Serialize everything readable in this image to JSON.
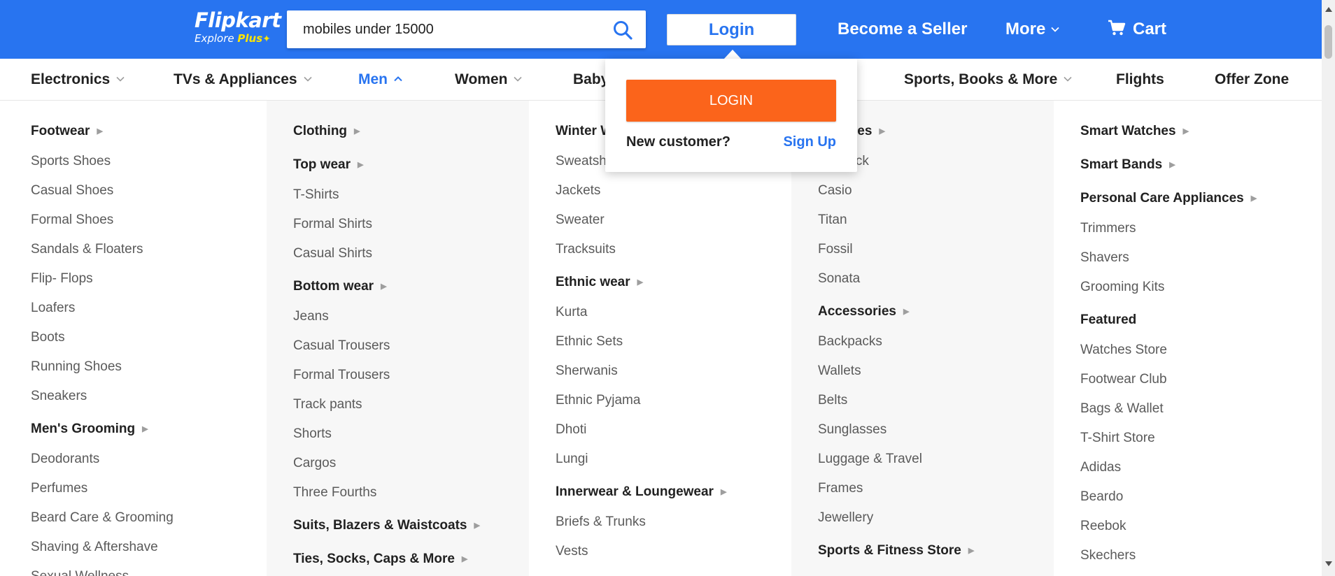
{
  "colors": {
    "brand": "#2874f0",
    "accent": "#ffe500",
    "login_button": "#fb641b"
  },
  "header": {
    "logo": {
      "name": "Flipkart",
      "tagline": "Explore",
      "plus": "Plus"
    },
    "search": {
      "value": "mobiles under 15000",
      "icon": "search-icon"
    },
    "login_label": "Login",
    "seller_label": "Become a Seller",
    "more_label": "More",
    "cart_label": "Cart"
  },
  "categories": [
    {
      "label": "Electronics",
      "has_dropdown": true
    },
    {
      "label": "TVs & Appliances",
      "has_dropdown": true
    },
    {
      "label": "Men",
      "has_dropdown": true,
      "active": true
    },
    {
      "label": "Women",
      "has_dropdown": true
    },
    {
      "label": "Baby",
      "has_dropdown": false
    },
    {
      "label": "Sports, Books & More",
      "has_dropdown": true
    },
    {
      "label": "Flights",
      "has_dropdown": false
    },
    {
      "label": "Offer Zone",
      "has_dropdown": false
    }
  ],
  "menu": {
    "columns": [
      [
        {
          "label": "Footwear",
          "type": "heading"
        },
        {
          "label": "Sports Shoes"
        },
        {
          "label": "Casual Shoes"
        },
        {
          "label": "Formal Shoes"
        },
        {
          "label": "Sandals & Floaters"
        },
        {
          "label": "Flip- Flops"
        },
        {
          "label": "Loafers"
        },
        {
          "label": "Boots"
        },
        {
          "label": "Running Shoes"
        },
        {
          "label": "Sneakers"
        },
        {
          "label": "Men's Grooming",
          "type": "heading"
        },
        {
          "label": "Deodorants"
        },
        {
          "label": "Perfumes"
        },
        {
          "label": "Beard Care & Grooming"
        },
        {
          "label": "Shaving & Aftershave"
        },
        {
          "label": "Sexual Wellness"
        }
      ],
      [
        {
          "label": "Clothing",
          "type": "heading"
        },
        {
          "label": "Top wear",
          "type": "heading"
        },
        {
          "label": "T-Shirts"
        },
        {
          "label": "Formal Shirts"
        },
        {
          "label": "Casual Shirts"
        },
        {
          "label": "Bottom wear",
          "type": "heading"
        },
        {
          "label": "Jeans"
        },
        {
          "label": "Casual Trousers"
        },
        {
          "label": "Formal Trousers"
        },
        {
          "label": "Track pants"
        },
        {
          "label": "Shorts"
        },
        {
          "label": "Cargos"
        },
        {
          "label": "Three Fourths"
        },
        {
          "label": "Suits, Blazers & Waistcoats",
          "type": "heading"
        },
        {
          "label": "Ties, Socks, Caps & More",
          "type": "heading"
        }
      ],
      [
        {
          "label": "Winter Wear",
          "type": "heading"
        },
        {
          "label": "Sweatshirts"
        },
        {
          "label": "Jackets"
        },
        {
          "label": "Sweater"
        },
        {
          "label": "Tracksuits"
        },
        {
          "label": "Ethnic wear",
          "type": "heading"
        },
        {
          "label": "Kurta"
        },
        {
          "label": "Ethnic Sets"
        },
        {
          "label": "Sherwanis"
        },
        {
          "label": "Ethnic Pyjama"
        },
        {
          "label": "Dhoti"
        },
        {
          "label": "Lungi"
        },
        {
          "label": "Innerwear & Loungewear",
          "type": "heading"
        },
        {
          "label": "Briefs & Trunks"
        },
        {
          "label": "Vests"
        }
      ],
      [
        {
          "label": "Watches",
          "type": "heading"
        },
        {
          "label": "Fastrack"
        },
        {
          "label": "Casio"
        },
        {
          "label": "Titan"
        },
        {
          "label": "Fossil"
        },
        {
          "label": "Sonata"
        },
        {
          "label": "Accessories",
          "type": "heading"
        },
        {
          "label": "Backpacks"
        },
        {
          "label": "Wallets"
        },
        {
          "label": "Belts"
        },
        {
          "label": "Sunglasses"
        },
        {
          "label": "Luggage & Travel"
        },
        {
          "label": "Frames"
        },
        {
          "label": "Jewellery"
        },
        {
          "label": "Sports & Fitness Store",
          "type": "heading"
        }
      ],
      [
        {
          "label": "Smart Watches",
          "type": "heading"
        },
        {
          "label": "Smart Bands",
          "type": "heading"
        },
        {
          "label": "Personal Care Appliances",
          "type": "heading"
        },
        {
          "label": "Trimmers"
        },
        {
          "label": "Shavers"
        },
        {
          "label": "Grooming Kits"
        },
        {
          "label": "Featured",
          "type": "heading",
          "no_arrow": true
        },
        {
          "label": "Watches Store"
        },
        {
          "label": "Footwear Club"
        },
        {
          "label": "Bags & Wallet"
        },
        {
          "label": "T-Shirt Store"
        },
        {
          "label": "Adidas"
        },
        {
          "label": "Beardo"
        },
        {
          "label": "Reebok"
        },
        {
          "label": "Skechers"
        }
      ]
    ]
  },
  "login_dropdown": {
    "button_label": "LOGIN",
    "new_customer_text": "New customer?",
    "signup_label": "Sign Up"
  }
}
